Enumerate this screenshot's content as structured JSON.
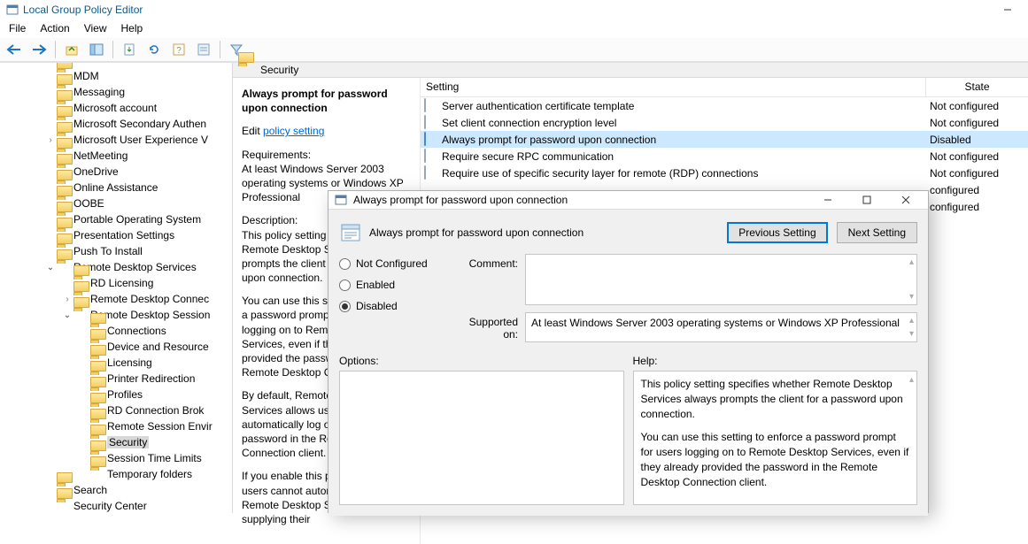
{
  "window": {
    "title": "Local Group Policy Editor",
    "menu": [
      "File",
      "Action",
      "View",
      "Help"
    ]
  },
  "tree": [
    {
      "depth": 4,
      "label": "MDM"
    },
    {
      "depth": 4,
      "label": "Messaging"
    },
    {
      "depth": 4,
      "label": "Microsoft account"
    },
    {
      "depth": 4,
      "label": "Microsoft Secondary Authen"
    },
    {
      "depth": 4,
      "label": "Microsoft User Experience V",
      "expander": "closed"
    },
    {
      "depth": 4,
      "label": "NetMeeting"
    },
    {
      "depth": 4,
      "label": "OneDrive"
    },
    {
      "depth": 4,
      "label": "Online Assistance"
    },
    {
      "depth": 4,
      "label": "OOBE"
    },
    {
      "depth": 4,
      "label": "Portable Operating System"
    },
    {
      "depth": 4,
      "label": "Presentation Settings"
    },
    {
      "depth": 4,
      "label": "Push To Install"
    },
    {
      "depth": 4,
      "label": "Remote Desktop Services",
      "expander": "open"
    },
    {
      "depth": 5,
      "label": "RD Licensing"
    },
    {
      "depth": 5,
      "label": "Remote Desktop Connec",
      "expander": "closed"
    },
    {
      "depth": 5,
      "label": "Remote Desktop Session",
      "expander": "open"
    },
    {
      "depth": 6,
      "label": "Connections"
    },
    {
      "depth": 6,
      "label": "Device and Resource"
    },
    {
      "depth": 6,
      "label": "Licensing"
    },
    {
      "depth": 6,
      "label": "Printer Redirection"
    },
    {
      "depth": 6,
      "label": "Profiles"
    },
    {
      "depth": 6,
      "label": "RD Connection Brok"
    },
    {
      "depth": 6,
      "label": "Remote Session Envir"
    },
    {
      "depth": 6,
      "label": "Security",
      "selected": true
    },
    {
      "depth": 6,
      "label": "Session Time Limits"
    },
    {
      "depth": 6,
      "label": "Temporary folders"
    },
    {
      "depth": 4,
      "label": "Search"
    },
    {
      "depth": 4,
      "label": "Security Center"
    }
  ],
  "content": {
    "header": "Security",
    "help": {
      "title": "Always prompt for password upon connection",
      "edit_prefix": "Edit ",
      "edit_link": "policy setting",
      "req_label": "Requirements:",
      "req_text": "At least Windows Server 2003 operating systems or Windows XP Professional",
      "desc_label": "Description:",
      "desc_p1": "This policy setting specifies whether Remote Desktop Services always prompts the client for a password upon connection.",
      "desc_p2": "You can use this setting to enforce a password prompt for users logging on to Remote Desktop Services, even if they already provided the password in the Remote Desktop Connection client.",
      "desc_p3": "By default, Remote Desktop Services allows users to automatically log on by entering a password in the Remote Desktop Connection client.",
      "desc_p4": "If you enable this policy setting, users cannot automatically log on to Remote Desktop Services by supplying their"
    },
    "columns": {
      "setting": "Setting",
      "state": "State"
    },
    "rows": [
      {
        "setting": "Server authentication certificate template",
        "state": "Not configured"
      },
      {
        "setting": "Set client connection encryption level",
        "state": "Not configured"
      },
      {
        "setting": "Always prompt for password upon connection",
        "state": "Disabled",
        "selected": true
      },
      {
        "setting": "Require secure RPC communication",
        "state": "Not configured"
      },
      {
        "setting": "Require use of specific security layer for remote (RDP) connections",
        "state": "Not configured"
      },
      {
        "setting": "",
        "state": "configured"
      },
      {
        "setting": "",
        "state": "configured"
      }
    ]
  },
  "dialog": {
    "title": "Always prompt for password upon connection",
    "name": "Always prompt for password upon connection",
    "prev": "Previous Setting",
    "next": "Next Setting",
    "radios": {
      "nc": "Not Configured",
      "en": "Enabled",
      "dis": "Disabled",
      "selected": "dis"
    },
    "comment_label": "Comment:",
    "supported_label": "Supported on:",
    "supported_value": "At least Windows Server 2003 operating systems or Windows XP Professional",
    "options_label": "Options:",
    "help_label": "Help:",
    "help_p1": "This policy setting specifies whether Remote Desktop Services always prompts the client for a password upon connection.",
    "help_p2": "You can use this setting to enforce a password prompt for users logging on to Remote Desktop Services, even if they already provided the password in the Remote Desktop Connection client."
  }
}
